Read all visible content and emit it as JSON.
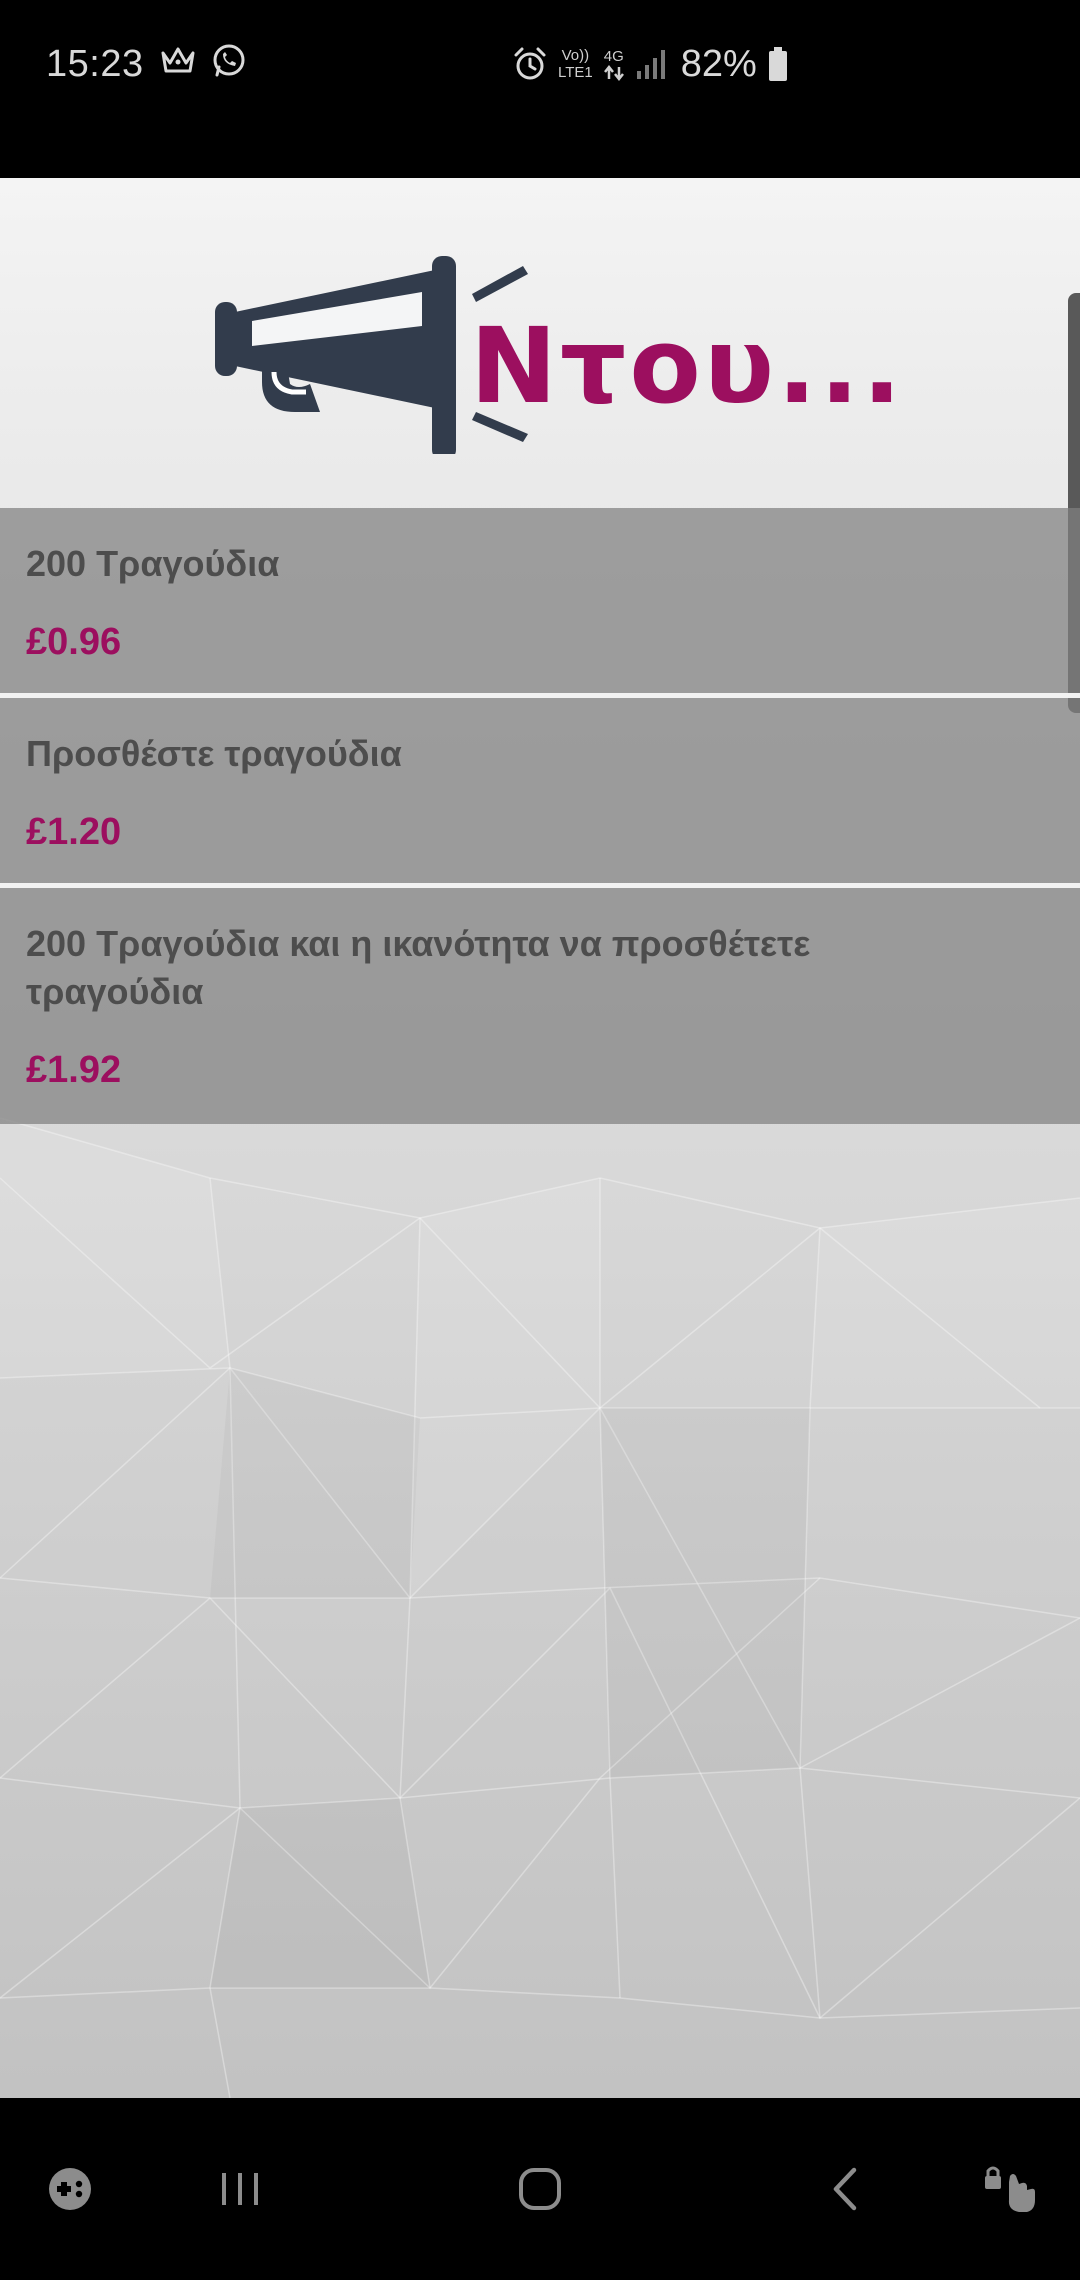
{
  "status_bar": {
    "time": "15:23",
    "volte_label_top": "Vo))",
    "volte_label_bottom": "LTE1",
    "network_type": "4G",
    "battery": "82%"
  },
  "header": {
    "logo_text": "Ντου...",
    "logo_text_color": "#9c0f5f",
    "logo_icon_color": "#323c4c"
  },
  "products": [
    {
      "title": "200 Τραγούδια",
      "price": "£0.96"
    },
    {
      "title": "Προσθέστε τραγούδια",
      "price": "£1.20"
    },
    {
      "title": "200 Τραγούδια και η ικανότητα να προσθέτετε τραγούδια",
      "price": "£1.92"
    }
  ],
  "navigation": {
    "icons": [
      "game-launcher-icon",
      "recent-apps-icon",
      "home-icon",
      "back-icon",
      "accessibility-icon"
    ]
  },
  "colors": {
    "accent": "#9c0f5f",
    "title_text": "#4d4d4d",
    "item_background": "#8a8a8a"
  }
}
